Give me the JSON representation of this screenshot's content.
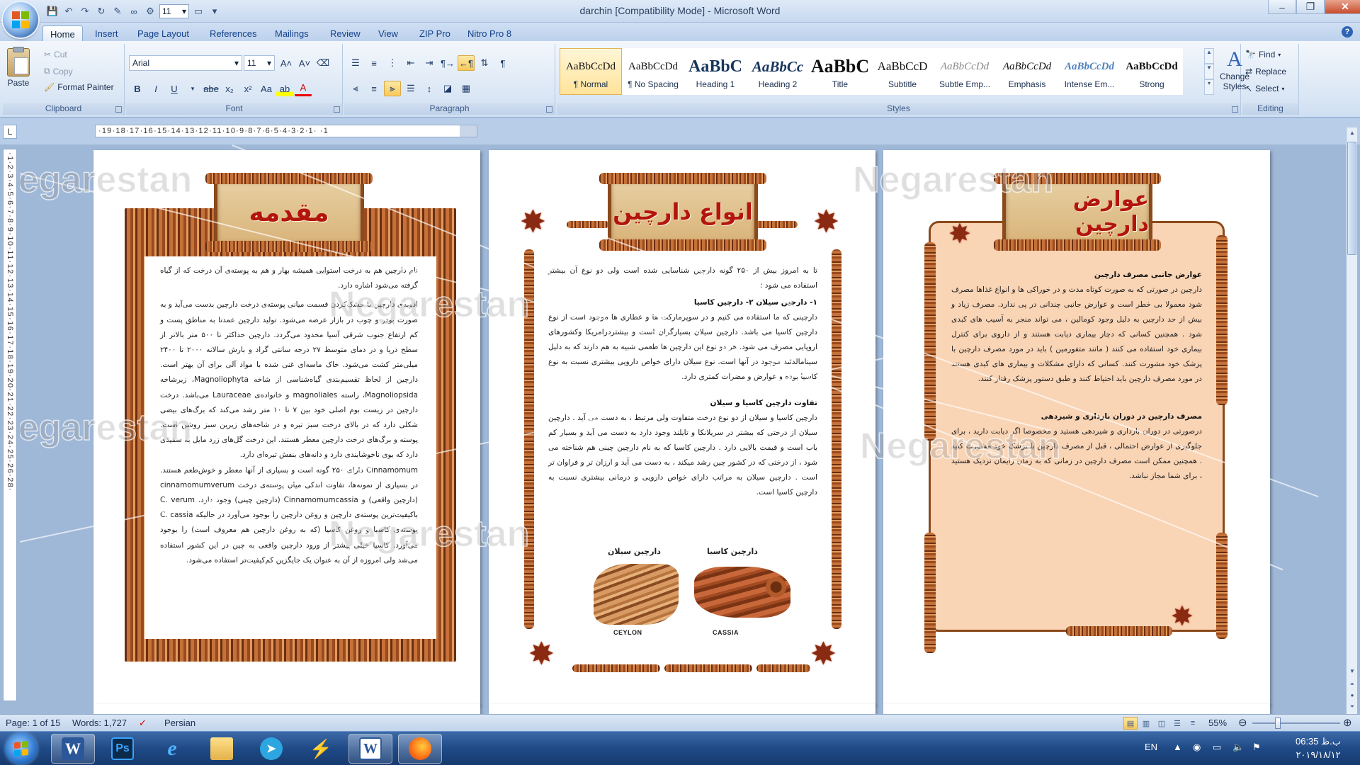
{
  "window": {
    "title": "darchin [Compatibility Mode] - Microsoft Word",
    "font_size_qat": "11",
    "minimize_label": "–",
    "maximize_label": "❐",
    "close_label": "✕"
  },
  "tabs": [
    "Home",
    "Insert",
    "Page Layout",
    "References",
    "Mailings",
    "Review",
    "View",
    "ZIP Pro",
    "Nitro Pro 8"
  ],
  "help_label": "?",
  "ribbon": {
    "clipboard": {
      "label": "Clipboard",
      "paste": "Paste",
      "cut": "Cut",
      "copy": "Copy",
      "format_painter": "Format Painter"
    },
    "font": {
      "label": "Font",
      "font_name": "Arial",
      "font_size": "11"
    },
    "paragraph": {
      "label": "Paragraph"
    },
    "styles": {
      "label": "Styles",
      "items": [
        {
          "preview": "AaBbCcDd",
          "name": "¶ Normal",
          "active": true
        },
        {
          "preview": "AaBbCcDd",
          "name": "¶ No Spacing",
          "active": false
        },
        {
          "preview": "AaBbC",
          "name": "Heading 1",
          "active": false
        },
        {
          "preview": "AaBbCc",
          "name": "Heading 2",
          "active": false
        },
        {
          "preview": "AaBbC",
          "name": "Title",
          "active": false
        },
        {
          "preview": "AaBbCcD",
          "name": "Subtitle",
          "active": false
        },
        {
          "preview": "AaBbCcDd",
          "name": "Subtle Emp...",
          "active": false
        },
        {
          "preview": "AaBbCcDd",
          "name": "Emphasis",
          "active": false
        },
        {
          "preview": "AaBbCcDd",
          "name": "Intense Em...",
          "active": false
        },
        {
          "preview": "AaBbCcDd",
          "name": "Strong",
          "active": false
        }
      ],
      "change_styles": "Change Styles"
    },
    "editing": {
      "label": "Editing",
      "find": "Find",
      "replace": "Replace",
      "select": "Select"
    }
  },
  "ruler": {
    "tab_selector": "L",
    "horizontal_marks": "·19·18·17·16·15·14·13·12·11·10·9·8·7·6·5·4·3·2·1·   ·1",
    "vertical_marks": "·1·2·3·4·5·6·7·8·9·10·11·12·13·14·15·16·17·18·19·20·21·22·23·24·25·26·28·"
  },
  "watermark": "Negarestan",
  "pages": [
    {
      "title": "مقدمه",
      "paragraphs": [
        "نام دارچین هم به درخت استوایی همیشه بهار و هم به پوسته‌ی آن درخت که از گیاه گرفته می‌شود اشاره دارد.",
        "ادویه‌ی دارچین با خشک‌کردن قسمت میانی پوسته‌ی درخت دارچین بدست می‌آید و به صورت پودر و چوب در بازار عرضه می‌شود. تولید دارچین عمدتا به مناطق پست و کم ارتفاع جنوب شرقی آسیا محدود می‌گردد. دارچین حداکثر تا ۵۰۰ متر بالاتر از سطح دریا و در دمای متوسط ۲۷ درجه سانتی گراد و بارش سالانه ۲۰۰۰ تا ۲۴۰۰ میلی‌متر کشت می‌شود. خاک ماسه‌ای غنی شده با مواد آلی برای آن بهتر است. دارچین از لحاظ تقسیم‌بندی گیاه‌شناسی از شاخه Magnoliophyta، زیرشاخه Magnoliopsida، راسته magnoliales و خانواده‌ی Lauraceae می‌باشد. درخت دارچین در زیست بوم اصلی خود بین ۷ تا ۱۰ متر رشد می‌کند که برگ‌های بیضی شکلی دارد که در بالای درخت سبز تیره و در شاخه‌های زیرین سبز روشن است. پوسته و برگ‌های درخت دارچین معطر هستند. این درخت گل‌های زرد مایل به سفیدی دارد که بوی ناخوشایندی دارد و دانه‌های بنفش تیره‌ای دارد.",
        "Cinnamomum دارای ۲۵۰ گونه است و بسیاری از آنها معطر و خوش‌طعم هستند. در بسیاری از نمونه‌ها، تفاوت اندکی میان پوسته‌ی درخت cinnamomumverum (دارچین واقعی) و Cinnamomumcassia (دارچین چینی) وجود دارد. C. verum باکیفیت‌ترین پوسته‌ی دارچین و روغن دارچین را بوجود می‌آورد در حالیکه C. cassia پوسته‌ی کاسیا و روغن کاسیا (که به روغن دارچین هم معروف است) را بوجود می‌آورد. کاسیا خیلی پیشتر از ورود دارچین واقعی به چین در این کشور استفاده می‌شد ولی امروزه از آن به عنوان یک جایگزین کم‌کیفیت‌تر استفاده می‌شود."
      ]
    },
    {
      "title": "انواع دارچین",
      "intro": "تا به امروز بیش از ۲۵۰ گونه دارچین شناسایی شده است ولی دو نوع آن بیشتر استفاده می شود :",
      "subheading1": "۱- دارچین سیلان ۲- دارچین کاسیا",
      "paragraph1": "دارچینی که ما استفاده می کنیم و در سوپرمارکت ها و عطاری ها موجود است از نوع دارچین کاسیا می باشد. دارچین سیلان بسیارگران است و بیشتردرامریکا وکشورهای اروپایی مصرف می شود. هر دو نوع این دارچین ها طعمی شبیه به هم دارند که به دلیل سینامالدئید موجود در آنها است. نوع سیلان دارای خواص دارویی بیشتری نسبت به نوع کاسیا بوده و عوارض و مضرات کمتری دارد.",
      "subheading2": "تفاوت دارچین کاسیا و سیلان",
      "paragraph2": "دارچین کاسیا و سیلان از دو نوع درخت متفاوت ولی مرتبط ، به دست می آید . دارچین سیلان از درختی که بیشتر در سریلانکا و تایلند وجود دارد به دست می آید و بسیار کم یاب است و قیمت بالایی دارد . دارچین کاسیا که به نام دارچین چینی هم شناخته می شود ، از درختی که در کشور چین رشد میکند ، به دست می آید و ارزان تر و فراوان تر است . دارچین سیلان به مراتب دارای خواص دارویی و درمانی بیشتری نسبت به دارچین کاسیا است.",
      "label_ceylon": "دارچین سیلان",
      "label_cassia": "دارچین کاسیا",
      "caption_ceylon": "CEYLON",
      "caption_cassia": "CASSIA"
    },
    {
      "title": "عوارض دارچین",
      "subheading1": "عوارض جانبی مصرف دارچین",
      "paragraph1": "دارچین در صورتی که به صورت کوتاه مدت و در خوراکی ها و انواع غذاها مصرف شود معمولا بی خطر است و عوارض جانبی چندانی در پی ندارد. مصرف زیاد و بیش از حد دارچین به دلیل وجود کومالین ، می تواند منجر به آسیب های کبدی شود . همچنین کسانی که دچار بیماری دیابت هستند و از داروی برای کنترل بیماری خود استفاده می کنند ( مانند متفورمین ) باید در مورد مصرف دارچین با پزشک خود مشورت کنند. کسانی که دارای مشکلات و بیماری های کبدی هستند در مورد مصرف دارچین باید احتیاط کنند و طبق دستور پزشک رفتار کنند.",
      "subheading2": "مصرف دارچین در دوران بارداری و شیردهی",
      "paragraph2": "درصورتی در دوران بارداری و شیردهی هستید و مخصوصا اگر دیابت دارید ، برای جلوگیری از عوارض احتمالی ، قبل از مصرف دارچین با پزشک خود مشورت کنید . همچنین ممکن است مصرف دارچین در زمانی که به زمان زایمان نزدیک هستید ، برای شما مجاز نباشد."
    }
  ],
  "status": {
    "page": "Page: 1 of 15",
    "words": "Words: 1,727",
    "language": "Persian",
    "zoom": "55%"
  },
  "taskbar": {
    "apps": [
      "Microsoft Word",
      "Photoshop",
      "Internet Explorer",
      "File Explorer",
      "Telegram",
      "Flash",
      "Word Document",
      "Firefox"
    ],
    "language": "EN",
    "time": "06:35 ب.ظ",
    "date": "۲۰۱۹/۱۸/۱۲"
  },
  "colors": {
    "accent": "#2b579a",
    "sign_text": "#b3150e",
    "cinnamon": "#9a4a1d"
  }
}
